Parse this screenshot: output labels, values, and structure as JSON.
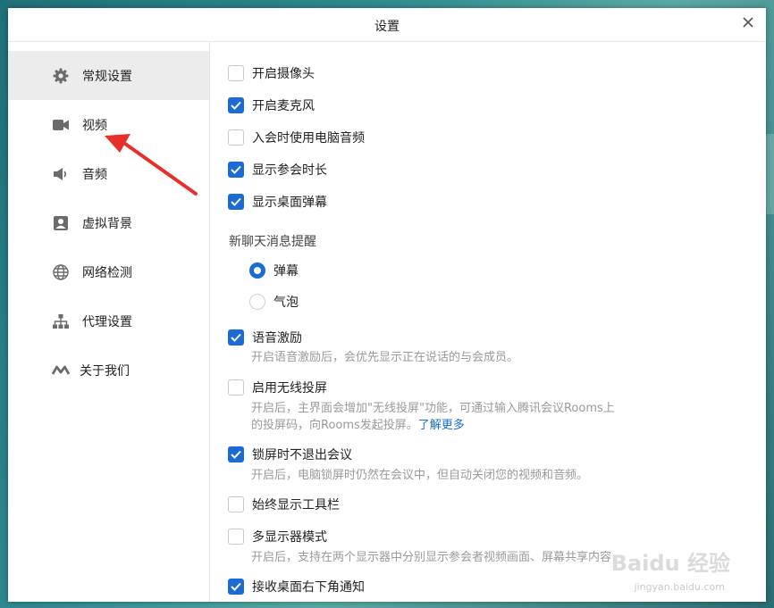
{
  "window": {
    "title": "设置"
  },
  "sidebar": {
    "items": [
      {
        "label": "常规设置",
        "icon": "gear-icon",
        "active": true
      },
      {
        "label": "视频",
        "icon": "video-camera-icon"
      },
      {
        "label": "音频",
        "icon": "speaker-icon"
      },
      {
        "label": "虚拟背景",
        "icon": "portrait-icon"
      },
      {
        "label": "网络检测",
        "icon": "globe-icon"
      },
      {
        "label": "代理设置",
        "icon": "network-tree-icon"
      },
      {
        "label": "关于我们",
        "icon": "logo-icon"
      }
    ]
  },
  "settings": {
    "camera_on": {
      "label": "开启摄像头",
      "checked": false
    },
    "mic_on": {
      "label": "开启麦克风",
      "checked": true
    },
    "pc_audio": {
      "label": "入会时使用电脑音频",
      "checked": false
    },
    "show_duration": {
      "label": "显示参会时长",
      "checked": true
    },
    "desktop_danmaku": {
      "label": "显示桌面弹幕",
      "checked": true
    },
    "chat_reminder": {
      "label": "新聊天消息提醒",
      "options": [
        {
          "label": "弹幕",
          "selected": true
        },
        {
          "label": "气泡",
          "selected": false
        }
      ]
    },
    "voice_excitation": {
      "label": "语音激励",
      "checked": true,
      "desc": "开启语音激励后，会优先显示正在说话的与会成员。"
    },
    "wireless_projection": {
      "label": "启用无线投屏",
      "checked": false,
      "desc_line1": "开启后，主界面会增加\"无线投屏\"功能，可通过输入腾讯会议Rooms上",
      "desc_line2": "的投屏码，向Rooms发起投屏。",
      "learn_more": "了解更多"
    },
    "lock_screen": {
      "label": "锁屏时不退出会议",
      "checked": true,
      "desc": "开启后，电脑锁屏时仍然在会议中，但自动关闭您的视频和音频。"
    },
    "show_toolbar": {
      "label": "始终显示工具栏",
      "checked": false
    },
    "multi_display": {
      "label": "多显示器模式",
      "checked": false,
      "desc": "开启后，支持在两个显示器中分别显示参会者视频画面、屏幕共享内容"
    },
    "desktop_notice": {
      "label": "接收桌面右下角通知",
      "checked": true
    }
  },
  "watermark": {
    "text": "Baidu 经验",
    "sub": "jingyan.baidu.com"
  },
  "colors": {
    "accent": "#1a6bd6",
    "arrow": "#e8302a"
  }
}
